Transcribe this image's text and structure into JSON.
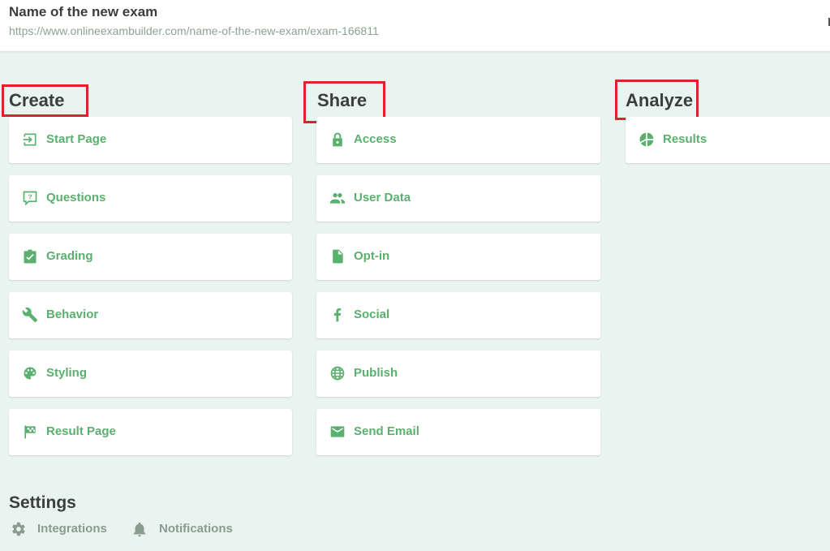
{
  "header": {
    "title": "Name of the new exam",
    "url": "https://www.onlineexambuilder.com/name-of-the-new-exam/exam-166811"
  },
  "colors": {
    "accent": "#5ab06e",
    "heading": "#3a3f3c",
    "background": "#e9f3ef",
    "highlight": "#e0202a",
    "muted": "#8a9c8f"
  },
  "sections": {
    "create": {
      "title": "Create",
      "items": [
        {
          "label": "Start Page",
          "icon": "login-icon"
        },
        {
          "label": "Questions",
          "icon": "question-bubble-icon"
        },
        {
          "label": "Grading",
          "icon": "clipboard-check-icon"
        },
        {
          "label": "Behavior",
          "icon": "wrench-icon"
        },
        {
          "label": "Styling",
          "icon": "palette-icon"
        },
        {
          "label": "Result Page",
          "icon": "checkered-flag-icon"
        }
      ]
    },
    "share": {
      "title": "Share",
      "items": [
        {
          "label": "Access",
          "icon": "lock-icon"
        },
        {
          "label": "User Data",
          "icon": "users-icon"
        },
        {
          "label": "Opt-in",
          "icon": "file-icon"
        },
        {
          "label": "Social",
          "icon": "facebook-icon"
        },
        {
          "label": "Publish",
          "icon": "globe-icon"
        },
        {
          "label": "Send Email",
          "icon": "mail-icon"
        }
      ]
    },
    "analyze": {
      "title": "Analyze",
      "items": [
        {
          "label": "Results",
          "icon": "pie-chart-icon"
        }
      ]
    }
  },
  "settings": {
    "title": "Settings",
    "items": [
      {
        "label": "Integrations",
        "icon": "gear-icon"
      },
      {
        "label": "Notifications",
        "icon": "bell-icon"
      }
    ]
  }
}
